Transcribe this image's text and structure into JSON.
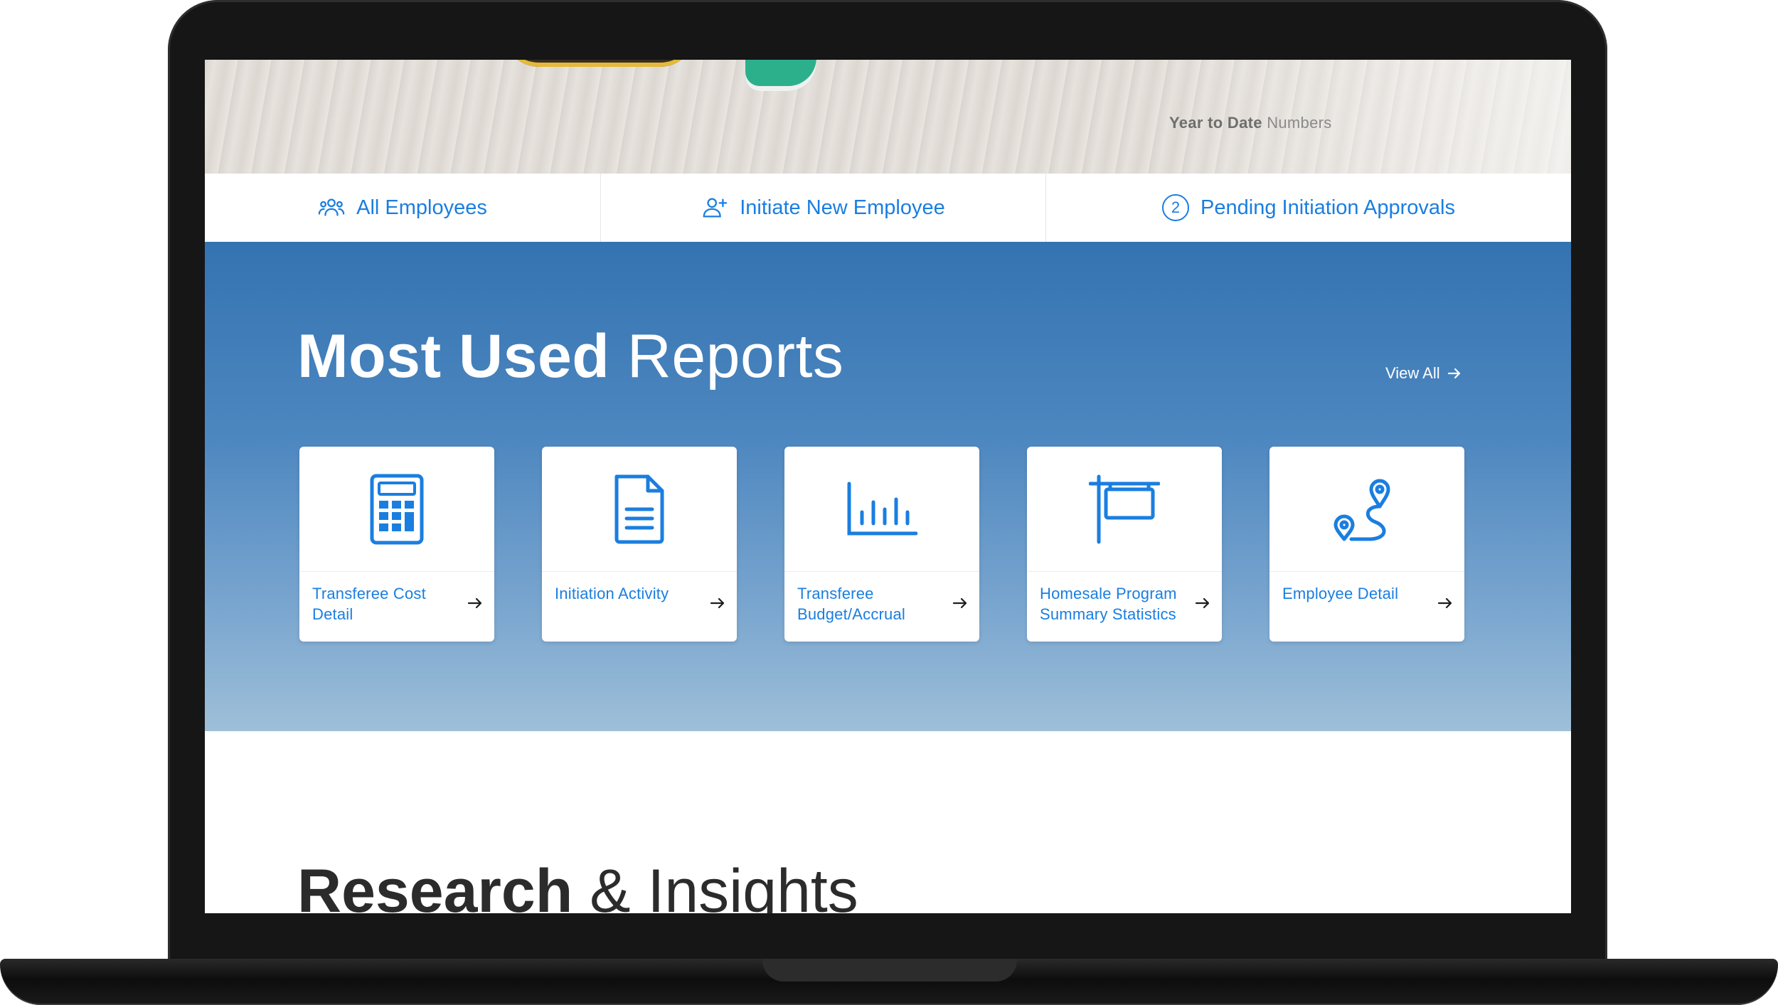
{
  "hero": {
    "ytd_bold": "Year to Date",
    "ytd_rest": "Numbers"
  },
  "quick_links": [
    {
      "label": "All Employees",
      "icon": "users-icon"
    },
    {
      "label": "Initiate New Employee",
      "icon": "user-plus-icon"
    },
    {
      "label": "Pending Initiation Approvals",
      "badge": "2"
    }
  ],
  "reports": {
    "title_bold": "Most Used",
    "title_light": "Reports",
    "view_all": "View All",
    "cards": [
      {
        "label": "Transferee Cost Detail",
        "icon": "calculator-icon"
      },
      {
        "label": "Initiation Activity",
        "icon": "document-icon"
      },
      {
        "label": "Transferee Budget/Accrual",
        "icon": "bar-chart-icon"
      },
      {
        "label": "Homesale Program Summary Statistics",
        "icon": "sign-post-icon"
      },
      {
        "label": "Employee Detail",
        "icon": "route-icon"
      }
    ]
  },
  "research": {
    "title_bold": "Research",
    "title_light": "& Insights"
  },
  "colors": {
    "accent": "#1a7ee0",
    "band_top": "#3473b1",
    "band_bottom": "#9ebfd8"
  }
}
